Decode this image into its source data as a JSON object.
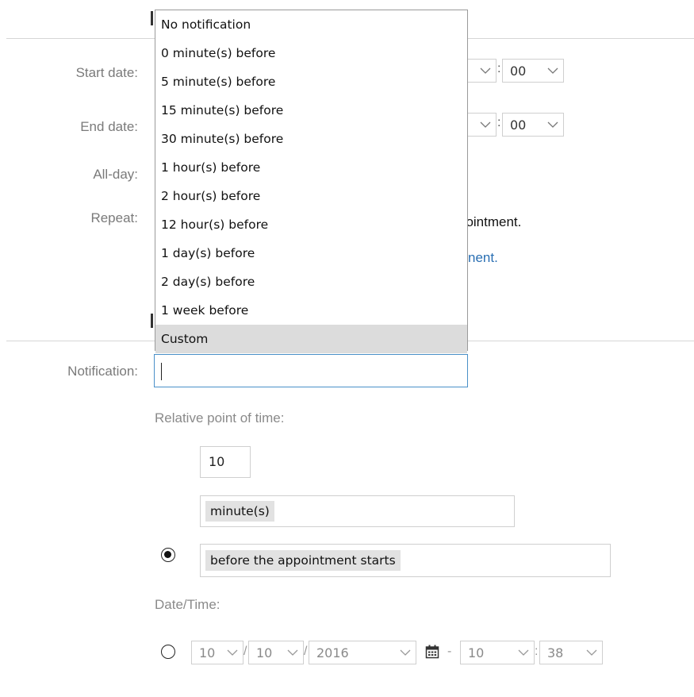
{
  "form": {
    "labels": {
      "start_date": "Start date:",
      "end_date": "End date:",
      "all_day": "All-day:",
      "repeat": "Repeat:",
      "notification": "Notification:"
    },
    "start_minute": "00",
    "end_minute": "00",
    "time_separator": ":",
    "repeat_text_tail": "pointment.",
    "repeat_link_tail": "nent."
  },
  "dropdown": {
    "options": [
      "No notification",
      "0 minute(s) before",
      "5 minute(s) before",
      "15 minute(s) before",
      "30 minute(s) before",
      "1 hour(s) before",
      "2 hour(s) before",
      "12 hour(s) before",
      "1 day(s) before",
      "2 day(s) before",
      "1 week before",
      "Custom"
    ],
    "highlighted": "Custom"
  },
  "notification": {
    "search_value": "",
    "relative_heading": "Relative point of time:",
    "relative_amount": "10",
    "relative_unit": "minute(s)",
    "relative_anchor": "before the appointment starts",
    "relative_selected": true,
    "datetime_heading": "Date/Time:",
    "datetime": {
      "month": "10",
      "day": "10",
      "year": "2016",
      "hour": "10",
      "minute": "38",
      "date_separator": "/",
      "time_separator": ":",
      "dash": "-"
    },
    "datetime_selected": false
  },
  "icons": {
    "chevron": "chevron-down-icon",
    "calendar": "calendar-icon"
  }
}
